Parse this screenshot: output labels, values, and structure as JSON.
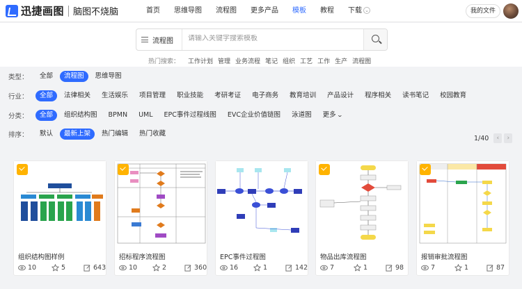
{
  "brand": {
    "name": "迅捷画图",
    "slogan": "脑图不烧脑"
  },
  "nav": [
    {
      "label": "首页",
      "active": false
    },
    {
      "label": "思维导图",
      "active": false
    },
    {
      "label": "流程图",
      "active": false
    },
    {
      "label": "更多产品",
      "active": false
    },
    {
      "label": "模板",
      "active": true
    },
    {
      "label": "教程",
      "active": false
    },
    {
      "label": "下载",
      "active": false
    }
  ],
  "header": {
    "my_files": "我的文件"
  },
  "search": {
    "category": "流程图",
    "placeholder": "请输入关键字搜索模板"
  },
  "hot_search": {
    "label": "热门搜索：",
    "terms": [
      "工作计划",
      "管理",
      "业务流程",
      "笔记",
      "组织",
      "工艺",
      "工作",
      "生产",
      "流程图"
    ]
  },
  "filters": {
    "type": {
      "label": "类型：",
      "options": [
        "全部",
        "流程图",
        "思维导图"
      ],
      "selected": "流程图"
    },
    "industry": {
      "label": "行业：",
      "options": [
        "全部",
        "法律相关",
        "生活娱乐",
        "项目管理",
        "职业技能",
        "考研考证",
        "电子商务",
        "教育培训",
        "产品设计",
        "程序相关",
        "读书笔记",
        "校园教育"
      ],
      "selected": "全部"
    },
    "category": {
      "label": "分类：",
      "options": [
        "全部",
        "组织结构图",
        "BPMN",
        "UML",
        "EPC事件过程线图",
        "EVC企业价值链图",
        "泳道图",
        "更多"
      ],
      "selected": "全部"
    },
    "sort": {
      "label": "排序：",
      "options": [
        "默认",
        "最新上架",
        "热门编辑",
        "热门收藏"
      ],
      "selected": "最新上架"
    }
  },
  "pagination": {
    "label": "1/40"
  },
  "cards": [
    {
      "title": "组织结构图样例",
      "views": "10",
      "stars": "5",
      "edits": "643"
    },
    {
      "title": "招标程序流程图",
      "views": "10",
      "stars": "2",
      "edits": "360"
    },
    {
      "title": "EPC事件过程图",
      "views": "16",
      "stars": "1",
      "edits": "142"
    },
    {
      "title": "物品出库流程图",
      "views": "7",
      "stars": "1",
      "edits": "98"
    },
    {
      "title": "报销审批流程图",
      "views": "7",
      "stars": "1",
      "edits": "87"
    }
  ],
  "colors": {
    "accent": "#2f6bff",
    "badge": "#ffb300"
  }
}
